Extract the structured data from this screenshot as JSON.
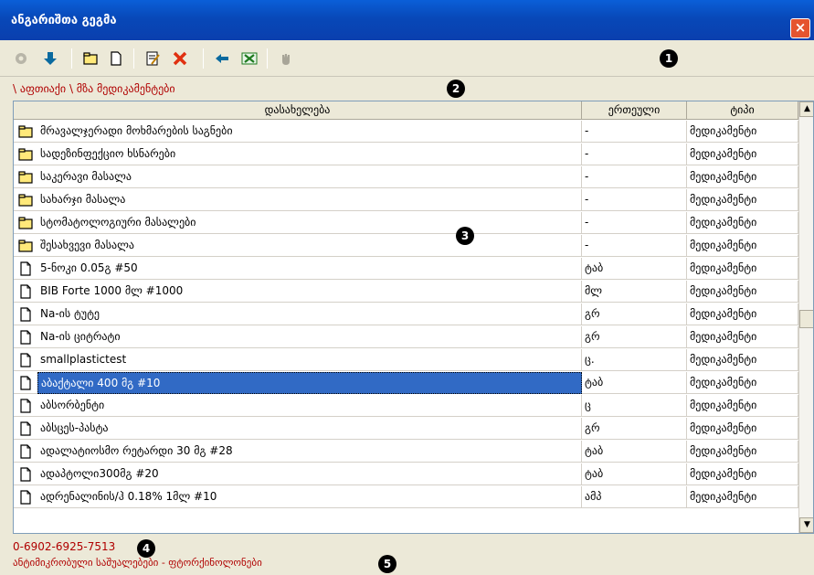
{
  "window": {
    "title": "ანგარიშთა გეგმა",
    "close_label": "×"
  },
  "toolbar": {
    "buttons": [
      {
        "icon": "settings-icon"
      },
      {
        "icon": "arrow-down-icon"
      },
      {
        "icon": "folder-icon"
      },
      {
        "icon": "new-document-icon"
      },
      {
        "icon": "edit-document-icon"
      },
      {
        "icon": "delete-icon"
      },
      {
        "icon": "arrow-left-icon"
      },
      {
        "icon": "excel-icon"
      },
      {
        "icon": "hand-icon"
      }
    ]
  },
  "markers": [
    "1",
    "2",
    "3",
    "4",
    "5"
  ],
  "breadcrumb": "\\ აფთიაქი \\ მზა მედიკამენტები",
  "table": {
    "columns": [
      "დასახელება",
      "ერთეული",
      "ტიპი"
    ],
    "rows": [
      {
        "icon": "folder-icon",
        "name": "მრავალჯერადი მოხმარების საგნები",
        "unit": "-",
        "type": "მედიკამენტი"
      },
      {
        "icon": "folder-icon",
        "name": "სადეზინფექციო ხსნარები",
        "unit": "-",
        "type": "მედიკამენტი"
      },
      {
        "icon": "folder-icon",
        "name": "საკერავი მასალა",
        "unit": "-",
        "type": "მედიკამენტი"
      },
      {
        "icon": "folder-icon",
        "name": "სახარჯი მასალა",
        "unit": "-",
        "type": "მედიკამენტი"
      },
      {
        "icon": "folder-icon",
        "name": "სტომატოლოგიური მასალები",
        "unit": "-",
        "type": "მედიკამენტი"
      },
      {
        "icon": "folder-icon",
        "name": "შესახვევი მასალა",
        "unit": "-",
        "type": "მედიკამენტი"
      },
      {
        "icon": "document-icon",
        "name": "5-ნოკი 0.05გ #50",
        "unit": "ტაბ",
        "type": "მედიკამენტი"
      },
      {
        "icon": "document-icon",
        "name": "BIB Forte 1000 მლ #1000",
        "unit": "მლ",
        "type": "მედიკამენტი"
      },
      {
        "icon": "document-icon",
        "name": "Na-ის ტუტე",
        "unit": "გრ",
        "type": "მედიკამენტი"
      },
      {
        "icon": "document-icon",
        "name": "Na-ის ციტრატი",
        "unit": "გრ",
        "type": "მედიკამენტი"
      },
      {
        "icon": "document-icon",
        "name": "smallplastictest",
        "unit": "ც.",
        "type": "მედიკამენტი"
      },
      {
        "icon": "document-icon",
        "name": "აბაქტალი 400 მგ #10",
        "unit": "ტაბ",
        "type": "მედიკამენტი",
        "selected": true
      },
      {
        "icon": "document-icon",
        "name": "აბსორბენტი",
        "unit": "ც",
        "type": "მედიკამენტი"
      },
      {
        "icon": "document-icon",
        "name": "აბსცეს-პასტა",
        "unit": "გრ",
        "type": "მედიკამენტი"
      },
      {
        "icon": "document-icon",
        "name": "ადალატიოსმო რეტარდი 30 მგ #28",
        "unit": "ტაბ",
        "type": "მედიკამენტი"
      },
      {
        "icon": "document-icon",
        "name": "ადაპტოლი300მგ #20",
        "unit": "ტაბ",
        "type": "მედიკამენტი"
      },
      {
        "icon": "document-icon",
        "name": "ადრენალინის/ჰ 0.18% 1მლ #10",
        "unit": "ამპ",
        "type": "მედიკამენტი"
      }
    ]
  },
  "scrollbar": {
    "up": "▲",
    "down": "▼"
  },
  "status": {
    "code": "0-6902-6925-7513",
    "description": "ანტიმიკრობული საშუალებები - ფტორქინოლონები"
  },
  "colors": {
    "title_bar": "#0A5FD8",
    "status_text": "#B00000",
    "selection": "#316AC5"
  }
}
